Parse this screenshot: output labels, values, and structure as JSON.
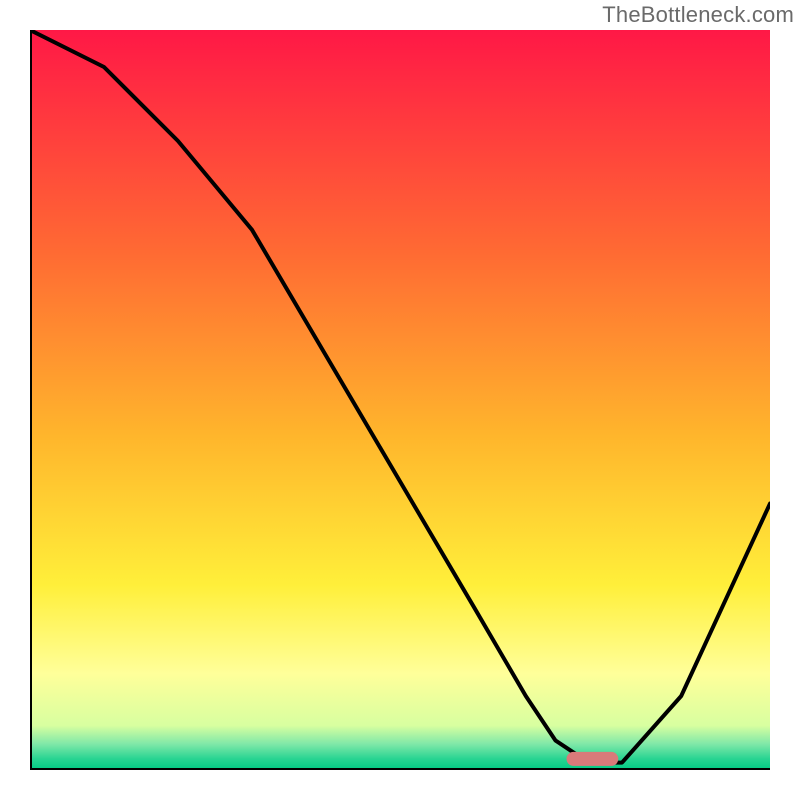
{
  "watermark": "TheBottleneck.com",
  "chart_data": {
    "type": "line",
    "title": "",
    "xlabel": "",
    "ylabel": "",
    "xlim": [
      0,
      100
    ],
    "ylim": [
      0,
      100
    ],
    "grid": false,
    "background_gradient": {
      "orientation": "vertical",
      "stops": [
        {
          "pos": 0.0,
          "color": "#ff1846"
        },
        {
          "pos": 0.3,
          "color": "#ff6a33"
        },
        {
          "pos": 0.55,
          "color": "#ffb62c"
        },
        {
          "pos": 0.75,
          "color": "#ffef3a"
        },
        {
          "pos": 0.87,
          "color": "#ffff9a"
        },
        {
          "pos": 0.94,
          "color": "#d8ffa0"
        },
        {
          "pos": 0.965,
          "color": "#7fe8a8"
        },
        {
          "pos": 0.985,
          "color": "#28d492"
        },
        {
          "pos": 1.0,
          "color": "#00c983"
        }
      ]
    },
    "series": [
      {
        "name": "bottleneck-curve",
        "x": [
          0,
          10,
          20,
          25,
          30,
          40,
          50,
          60,
          67,
          71,
          74,
          78,
          80,
          88,
          94,
          100
        ],
        "y": [
          100,
          95,
          85,
          79,
          73,
          56,
          39,
          22,
          10,
          4,
          2,
          1,
          1,
          10,
          23,
          36
        ]
      }
    ],
    "marker": {
      "name": "sweet-spot",
      "shape": "rounded-bar",
      "x_center": 76,
      "x_width": 7,
      "y": 1.5,
      "color": "#d87a7a"
    },
    "axes": {
      "ticks_x": [],
      "ticks_y": []
    }
  }
}
